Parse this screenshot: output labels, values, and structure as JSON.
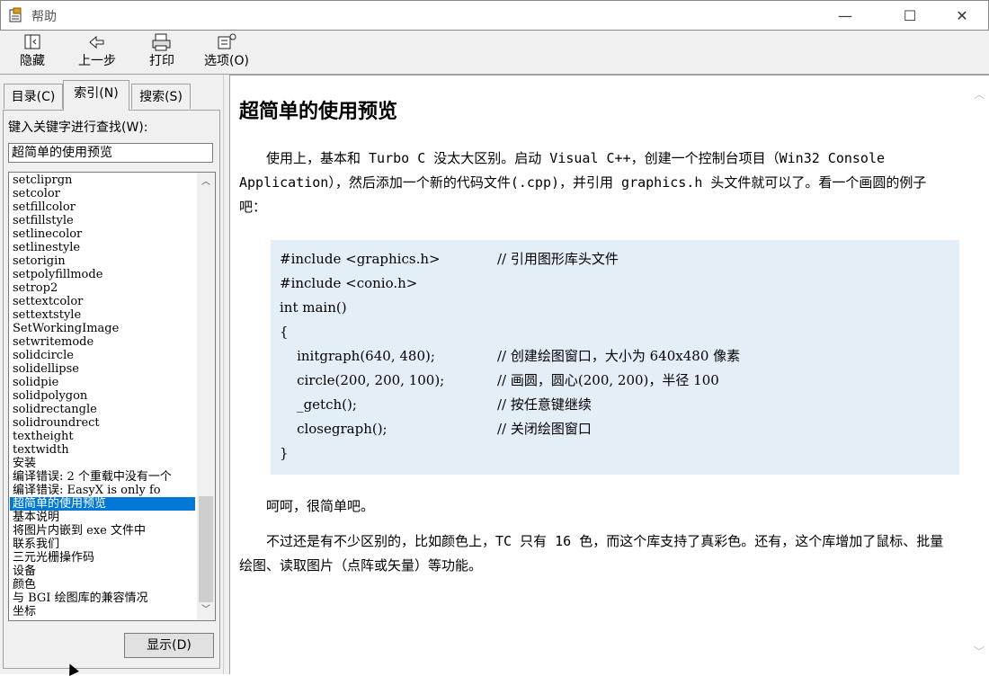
{
  "window": {
    "title": "帮助",
    "minimize": "—",
    "maximize": "☐",
    "close": "✕"
  },
  "toolbar": {
    "hide_label": "隐藏",
    "back_label": "上一步",
    "print_label": "打印",
    "options_label": "选项(O)",
    "hide_icon": "hide-icon",
    "back_icon": "back-arrow-icon",
    "print_icon": "printer-icon",
    "options_icon": "options-icon"
  },
  "tabs": {
    "contents": "目录(C)",
    "index": "索引(N)",
    "search": "搜索(S)",
    "active": "index"
  },
  "index": {
    "keyword_label": "键入关键字进行查找(W):",
    "keyword_value": "超简单的使用预览",
    "items": [
      "setcliprgn",
      "setcolor",
      "setfillcolor",
      "setfillstyle",
      "setlinecolor",
      "setlinestyle",
      "setorigin",
      "setpolyfillmode",
      "setrop2",
      "settextcolor",
      "settextstyle",
      "SetWorkingImage",
      "setwritemode",
      "solidcircle",
      "solidellipse",
      "solidpie",
      "solidpolygon",
      "solidrectangle",
      "solidroundrect",
      "textheight",
      "textwidth",
      "安装",
      "编译错误: 2 个重载中没有一个",
      "编译错误: EasyX is only fo",
      "超简单的使用预览",
      "基本说明",
      "将图片内嵌到 exe 文件中",
      "联系我们",
      "三元光栅操作码",
      "设备",
      "颜色",
      "与 BGI 绘图库的兼容情况",
      "坐标"
    ],
    "selected_index": 24,
    "display_button": "显示(D)"
  },
  "content": {
    "title": "超简单的使用预览",
    "para1": "使用上，基本和 Turbo C 没太大区别。启动 Visual C++，创建一个控制台项目（Win32 Console Application），然后添加一个新的代码文件(.cpp)，并引用 graphics.h 头文件就可以了。看一个画圆的例子吧：",
    "code_lines": [
      "#include <graphics.h>",
      "#include <conio.h>",
      "int main()",
      "{",
      "    initgraph(640, 480);",
      "    circle(200, 200, 100);",
      "    _getch();",
      "    closegraph();",
      "}"
    ],
    "code_comments": [
      "// 引用图形库头文件",
      "",
      "",
      "",
      "// 创建绘图窗口，大小为 640x480 像素",
      "// 画圆，圆心(200, 200)，半径 100",
      "// 按任意键继续",
      "// 关闭绘图窗口",
      ""
    ],
    "para2": "呵呵，很简单吧。",
    "para3": "不过还是有不少区别的，比如颜色上，TC 只有 16 色，而这个库支持了真彩色。还有，这个库增加了鼠标、批量绘图、读取图片（点阵或矢量）等功能。"
  },
  "colors": {
    "selection": "#0078d7",
    "code_bg": "#e4eef7",
    "chrome": "#f0f0f0"
  }
}
